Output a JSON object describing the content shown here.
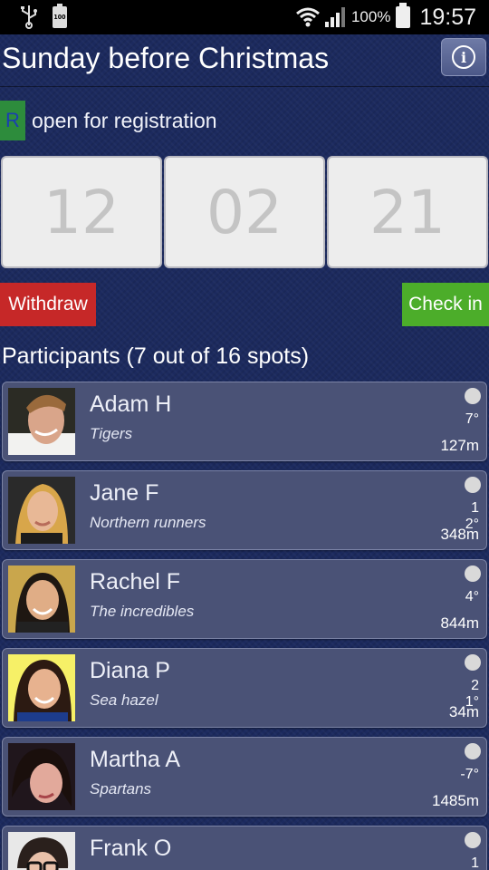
{
  "status_bar": {
    "icons": [
      "usb-icon",
      "battery-100-icon",
      "wifi-icon",
      "signal-icon",
      "battery-icon"
    ],
    "battery_small_text": "100",
    "battery_percent": "100%",
    "time": "19:57"
  },
  "header": {
    "title": "Sunday before Christmas",
    "info_icon": "info-icon"
  },
  "registration": {
    "badge": "R",
    "label": "open for registration",
    "badge_color": "#2d8c3c"
  },
  "countdown": [
    "12",
    "02",
    "21"
  ],
  "actions": {
    "withdraw_label": "Withdraw",
    "checkin_label": "Check in",
    "withdraw_color": "#c62828",
    "checkin_color": "#4cad2a"
  },
  "participants": {
    "heading": "Participants (7 out of 16 spots)",
    "items": [
      {
        "name": "Adam H",
        "team": "Tigers",
        "heading": "7°",
        "distance": "127m"
      },
      {
        "name": "Jane F",
        "team": "Northern runners",
        "heading": "12°",
        "distance": "348m"
      },
      {
        "name": "Rachel F",
        "team": "The incredibles",
        "heading": "4°",
        "distance": "844m"
      },
      {
        "name": "Diana P",
        "team": "Sea hazel",
        "heading": "21°",
        "distance": "34m"
      },
      {
        "name": "Martha A",
        "team": "Spartans",
        "heading": "-7°",
        "distance": "1485m"
      },
      {
        "name": "Frank O",
        "team": "",
        "heading": "1",
        "distance": ""
      }
    ]
  }
}
